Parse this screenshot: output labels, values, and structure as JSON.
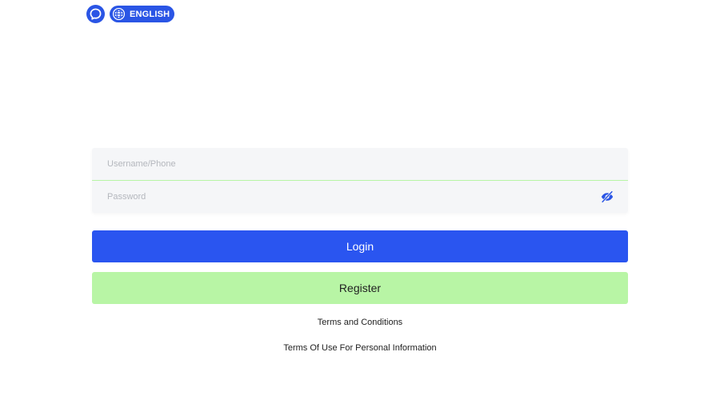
{
  "header": {
    "chat_icon": "chat-bubble-icon",
    "language": {
      "icon": "globe-icon",
      "label": "ENGLISH"
    }
  },
  "form": {
    "username": {
      "placeholder": "Username/Phone",
      "value": ""
    },
    "password": {
      "placeholder": "Password",
      "value": "",
      "toggle_icon": "eye-slash-icon"
    },
    "divider_color": "#b8f5a5"
  },
  "buttons": {
    "login_label": "Login",
    "register_label": "Register"
  },
  "links": {
    "terms": "Terms and Conditions",
    "privacy": "Terms Of Use For Personal Information"
  },
  "colors": {
    "primary": "#2a55f0",
    "accent_green": "#b8f5a5",
    "field_bg": "#f5f6f8"
  }
}
